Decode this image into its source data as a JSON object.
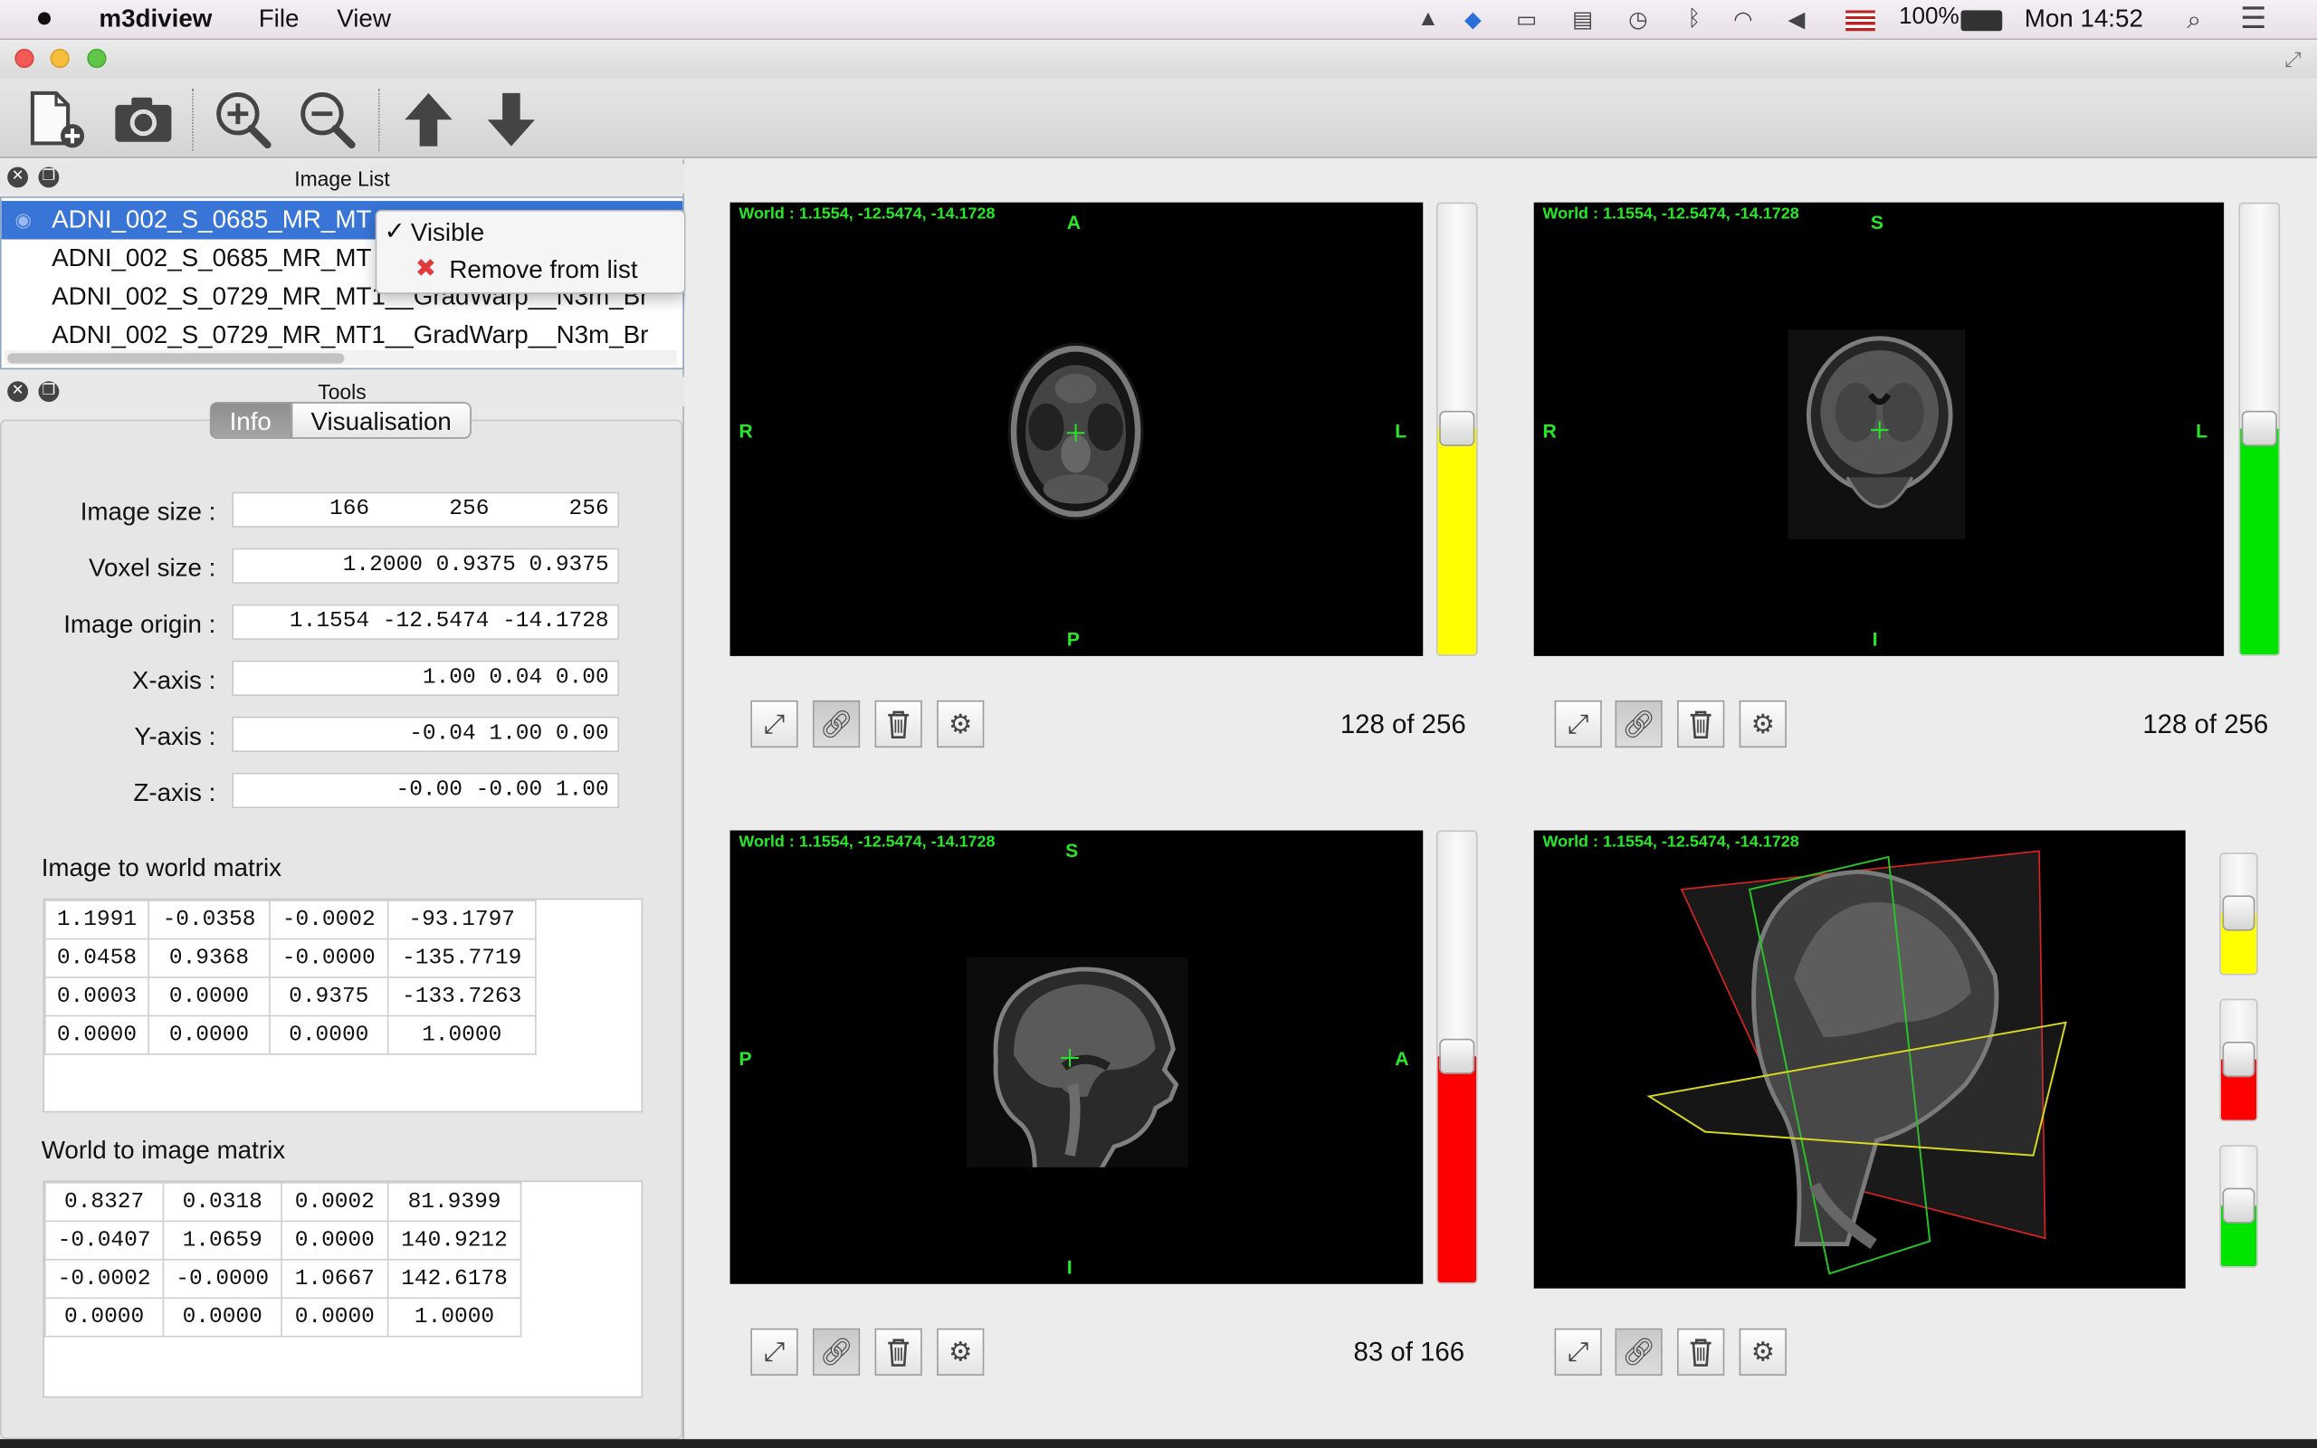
{
  "menubar": {
    "app": "m3diview",
    "menus": [
      "File",
      "View"
    ],
    "battery": "100%",
    "clock": "Mon 14:52"
  },
  "image_list": {
    "title": "Image List",
    "items": [
      "ADNI_002_S_0685_MR_MT",
      "ADNI_002_S_0685_MR_MT",
      "ADNI_002_S_0729_MR_MT1__GradWarp__N3m_Br",
      "ADNI_002_S_0729_MR_MT1__GradWarp__N3m_Br"
    ],
    "context_menu": {
      "visible": "Visible",
      "remove": "Remove from list"
    }
  },
  "tools": {
    "title": "Tools",
    "tabs": [
      "Info",
      "Visualisation"
    ],
    "fields": [
      {
        "label": "Image size :",
        "value": "166      256      256"
      },
      {
        "label": "Voxel size :",
        "value": "1.2000 0.9375 0.9375"
      },
      {
        "label": "Image origin :",
        "value": "1.1554 -12.5474 -14.1728"
      },
      {
        "label": "X-axis :",
        "value": "1.00 0.04 0.00"
      },
      {
        "label": "Y-axis :",
        "value": "-0.04 1.00 0.00"
      },
      {
        "label": "Z-axis :",
        "value": "-0.00 -0.00 1.00"
      }
    ],
    "i2w_title": "Image to world matrix",
    "i2w": [
      [
        "1.1991",
        "-0.0358",
        "-0.0002",
        "-93.1797"
      ],
      [
        "0.0458",
        "0.9368",
        "-0.0000",
        "-135.7719"
      ],
      [
        "0.0003",
        "0.0000",
        "0.9375",
        "-133.7263"
      ],
      [
        "0.0000",
        "0.0000",
        "0.0000",
        "1.0000"
      ]
    ],
    "w2i_title": "World to image matrix",
    "w2i": [
      [
        "0.8327",
        "0.0318",
        "0.0002",
        "81.9399"
      ],
      [
        "-0.0407",
        "1.0659",
        "0.0000",
        "140.9212"
      ],
      [
        "-0.0002",
        "-0.0000",
        "1.0667",
        "142.6178"
      ],
      [
        "0.0000",
        "0.0000",
        "0.0000",
        "1.0000"
      ]
    ]
  },
  "viewers": {
    "world": "World : 1.1554, -12.5474, -14.1728",
    "axial": {
      "top": "A",
      "left": "R",
      "right": "L",
      "bottom": "P",
      "slice": "128 of 256",
      "slider_fill": 0.5,
      "color": "#ffff00"
    },
    "coronal": {
      "top": "S",
      "left": "R",
      "right": "L",
      "bottom": "I",
      "slice": "128 of 256",
      "slider_fill": 0.5,
      "color": "#00e400"
    },
    "sagittal": {
      "top": "S",
      "left": "P",
      "right": "A",
      "bottom": "I",
      "slice": "83 of 166",
      "slider_fill": 0.5,
      "color": "#ff0000"
    },
    "volume": {
      "sliders": [
        {
          "color": "#ffff00",
          "fill": 0.5
        },
        {
          "color": "#ff0000",
          "fill": 0.5
        },
        {
          "color": "#00e400",
          "fill": 0.5
        }
      ]
    }
  }
}
